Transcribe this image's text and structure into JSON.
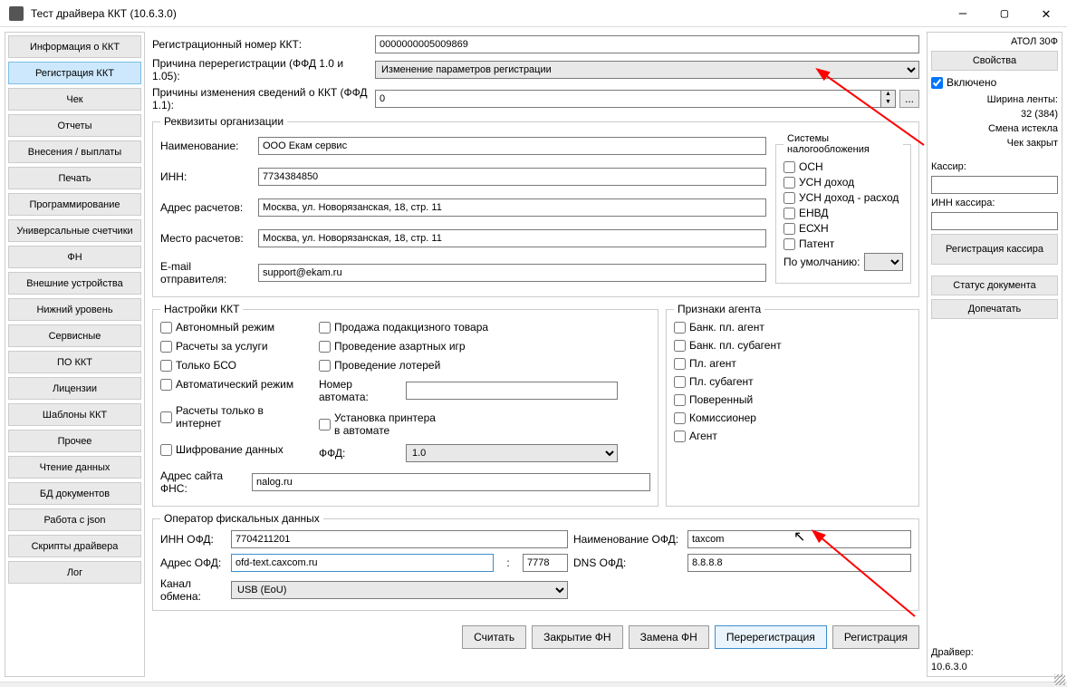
{
  "window": {
    "title": "Тест драйвера ККТ (10.6.3.0)"
  },
  "sidebar": {
    "items": [
      "Информация о ККТ",
      "Регистрация ККТ",
      "Чек",
      "Отчеты",
      "Внесения / выплаты",
      "Печать",
      "Программирование",
      "Универсальные счетчики",
      "ФН",
      "Внешние устройства",
      "Нижний уровень",
      "Сервисные",
      "ПО ККТ",
      "Лицензии",
      "Шаблоны ККТ",
      "Прочее",
      "Чтение данных",
      "БД документов",
      "Работа с json",
      "Скрипты драйвера",
      "Лог"
    ],
    "active_index": 1
  },
  "top": {
    "reg_label": "Регистрационный номер ККТ:",
    "reg_value": "0000000005009869",
    "rereg_label": "Причина перерегистрации (ФФД 1.0 и 1.05):",
    "rereg_value": "Изменение параметров регистрации",
    "reasons_label": "Причины изменения сведений о ККТ (ФФД 1.1):",
    "reasons_value": "0",
    "dots": "..."
  },
  "org": {
    "legend": "Реквизиты организации",
    "name_l": "Наименование:",
    "name_v": "ООО Екам сервис",
    "inn_l": "ИНН:",
    "inn_v": "7734384850",
    "addr_l": "Адрес расчетов:",
    "addr_v": "Москва, ул. Новорязанская, 18, стр. 11",
    "place_l": "Место расчетов:",
    "place_v": "Москва, ул. Новорязанская, 18, стр. 11",
    "email_l": "E-mail отправителя:",
    "email_v": "support@ekam.ru",
    "tax_legend": "Системы налогообложения",
    "tax": [
      "ОСН",
      "УСН доход",
      "УСН доход - расход",
      "ЕНВД",
      "ЕСХН",
      "Патент"
    ],
    "default_l": "По умолчанию:",
    "default_v": ""
  },
  "kkt": {
    "legend": "Настройки ККТ",
    "col1": [
      "Автономный режим",
      "Расчеты за услуги",
      "Только БСО",
      "Автоматический режим",
      "Расчеты только в интернет",
      "Шифрование данных"
    ],
    "col2": {
      "c1": "Продажа подакцизного товара",
      "c2": "Проведение азартных игр",
      "c3": "Проведение лотерей",
      "auto_l": "Номер автомата:",
      "auto_v": "",
      "printer": "Установка принтера в автомате",
      "ffd_l": "ФФД:",
      "ffd_v": "1.0"
    },
    "fns_l": "Адрес сайта ФНС:",
    "fns_v": "nalog.ru"
  },
  "agent": {
    "legend": "Признаки агента",
    "items": [
      "Банк. пл. агент",
      "Банк. пл. субагент",
      "Пл. агент",
      "Пл. субагент",
      "Поверенный",
      "Комиссионер",
      "Агент"
    ]
  },
  "ofd": {
    "legend": "Оператор фискальных данных",
    "inn_l": "ИНН ОФД:",
    "inn_v": "7704211201",
    "name_l": "Наименование ОФД:",
    "name_v": "taxcom",
    "addr_l": "Адрес ОФД:",
    "addr_v": "ofd-text.caxcom.ru",
    "port": "7778",
    "dns_l": "DNS ОФД:",
    "dns_v": "8.8.8.8",
    "chan_l": "Канал обмена:",
    "chan_v": "USB (EoU)"
  },
  "buttons": {
    "read": "Считать",
    "close_fn": "Закрытие ФН",
    "replace_fn": "Замена ФН",
    "rereg": "Перерегистрация",
    "reg": "Регистрация"
  },
  "right": {
    "model": "АТОЛ 30Ф",
    "props": "Свойства",
    "enabled": "Включено",
    "tape_l": "Ширина ленты:",
    "tape_v": "32 (384)",
    "shift": "Смена истекла",
    "cheque": "Чек закрыт",
    "cashier_l": "Кассир:",
    "cashier_v": "",
    "cinn_l": "ИНН кассира:",
    "cinn_v": "",
    "reg_cashier": "Регистрация кассира",
    "doc_status": "Статус документа",
    "reprint": "Допечатать",
    "driver_l": "Драйвер:",
    "driver_v": "10.6.3.0"
  }
}
